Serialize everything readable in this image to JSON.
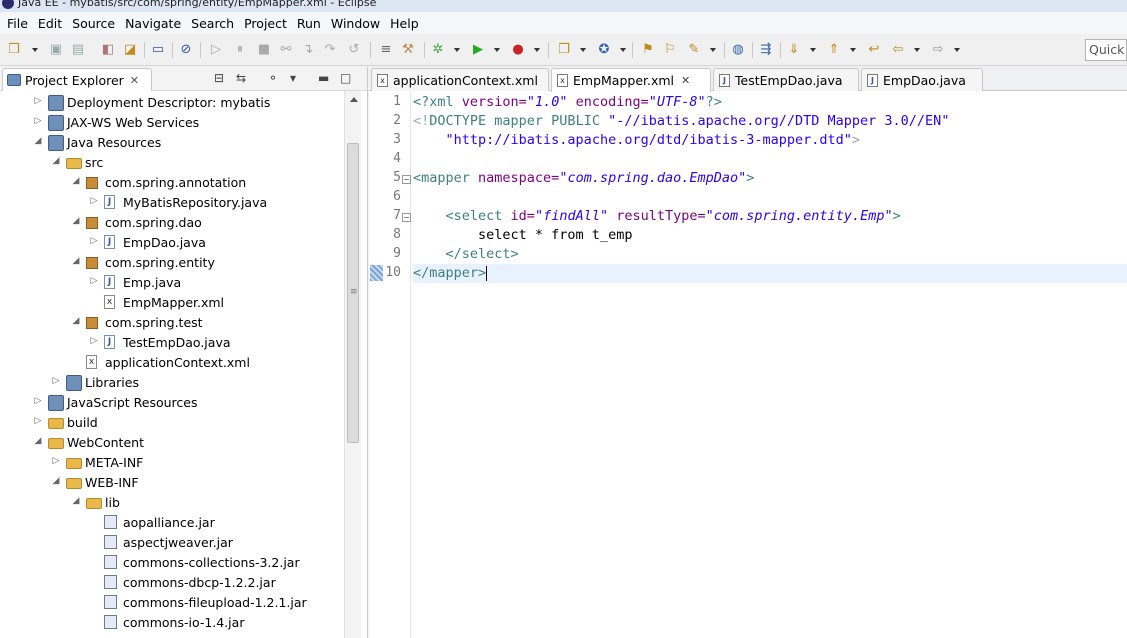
{
  "window": {
    "title": "Java EE - mybatis/src/com/spring/entity/EmpMapper.xml - Eclipse"
  },
  "menu": [
    "File",
    "Edit",
    "Source",
    "Navigate",
    "Search",
    "Project",
    "Run",
    "Window",
    "Help"
  ],
  "toolbar": {
    "quick_access": "Quick A"
  },
  "project_explorer": {
    "title": "Project Explorer",
    "items": [
      {
        "label": "Deployment Descriptor: mybatis",
        "icon": "deployment-descriptor-icon",
        "twisty": "collapsed"
      },
      {
        "label": "JAX-WS Web Services",
        "icon": "web-services-icon",
        "twisty": "collapsed"
      },
      {
        "label": "Java Resources",
        "icon": "java-resources-icon",
        "twisty": "expanded"
      },
      {
        "label": "src",
        "icon": "source-folder-icon",
        "twisty": "expanded"
      },
      {
        "label": "com.spring.annotation",
        "icon": "package-icon",
        "twisty": "expanded"
      },
      {
        "label": "MyBatisRepository.java",
        "icon": "java-file-icon",
        "twisty": "collapsed"
      },
      {
        "label": "com.spring.dao",
        "icon": "package-icon",
        "twisty": "expanded"
      },
      {
        "label": "EmpDao.java",
        "icon": "java-file-icon",
        "twisty": "collapsed"
      },
      {
        "label": "com.spring.entity",
        "icon": "package-icon",
        "twisty": "expanded"
      },
      {
        "label": "Emp.java",
        "icon": "java-file-icon",
        "twisty": "collapsed"
      },
      {
        "label": "EmpMapper.xml",
        "icon": "xml-file-icon",
        "twisty": "none"
      },
      {
        "label": "com.spring.test",
        "icon": "package-icon",
        "twisty": "expanded"
      },
      {
        "label": "TestEmpDao.java",
        "icon": "java-file-icon",
        "twisty": "collapsed"
      },
      {
        "label": "applicationContext.xml",
        "icon": "xml-file-icon",
        "twisty": "none"
      },
      {
        "label": "Libraries",
        "icon": "libraries-icon",
        "twisty": "collapsed"
      },
      {
        "label": "JavaScript Resources",
        "icon": "javascript-resources-icon",
        "twisty": "collapsed"
      },
      {
        "label": "build",
        "icon": "folder-icon",
        "twisty": "collapsed"
      },
      {
        "label": "WebContent",
        "icon": "folder-icon",
        "twisty": "expanded"
      },
      {
        "label": "META-INF",
        "icon": "folder-icon",
        "twisty": "collapsed"
      },
      {
        "label": "WEB-INF",
        "icon": "folder-icon",
        "twisty": "expanded"
      },
      {
        "label": "lib",
        "icon": "folder-icon",
        "twisty": "expanded"
      },
      {
        "label": "aopalliance.jar",
        "icon": "jar-file-icon",
        "twisty": "none"
      },
      {
        "label": "aspectjweaver.jar",
        "icon": "jar-file-icon",
        "twisty": "none"
      },
      {
        "label": "commons-collections-3.2.jar",
        "icon": "jar-file-icon",
        "twisty": "none"
      },
      {
        "label": "commons-dbcp-1.2.2.jar",
        "icon": "jar-file-icon",
        "twisty": "none"
      },
      {
        "label": "commons-fileupload-1.2.1.jar",
        "icon": "jar-file-icon",
        "twisty": "none"
      },
      {
        "label": "commons-io-1.4.jar",
        "icon": "jar-file-icon",
        "twisty": "none"
      }
    ]
  },
  "editor": {
    "tabs": [
      {
        "label": "applicationContext.xml",
        "icon": "xml-file-icon",
        "active": false
      },
      {
        "label": "EmpMapper.xml",
        "icon": "xml-file-icon",
        "active": true
      },
      {
        "label": "TestEmpDao.java",
        "icon": "java-file-icon",
        "active": false
      },
      {
        "label": "EmpDao.java",
        "icon": "java-file-icon",
        "active": false
      }
    ],
    "line_numbers": [
      "1",
      "2",
      "3",
      "4",
      "5",
      "6",
      "7",
      "8",
      "9",
      "10"
    ],
    "code": {
      "l1_open": "<?xml ",
      "l1_a1": "version=",
      "l1_v1": "\"1.0\"",
      "l1_a2": " encoding=",
      "l1_v2": "\"UTF-8\"",
      "l1_close": "?>",
      "l2_open": "<!",
      "l2_doctype": "DOCTYPE mapper PUBLIC ",
      "l2_str": "\"-//ibatis.apache.org//DTD Mapper 3.0//EN\"",
      "l3_indent": "    ",
      "l3_str": "\"http://ibatis.apache.org/dtd/ibatis-3-mapper.dtd\"",
      "l3_close": ">",
      "l5_open": "<mapper ",
      "l5_a1": "namespace=",
      "l5_v1": "\"com.spring.dao.EmpDao\"",
      "l5_close": ">",
      "l7_indent": "    ",
      "l7_open": "<select ",
      "l7_a1": "id=",
      "l7_v1": "\"findAll\"",
      "l7_a2": " resultType=",
      "l7_v2": "\"com.spring.entity.Emp\"",
      "l7_close": ">",
      "l8_text": "        select * from t_emp",
      "l9_indent": "    ",
      "l9_tag": "</select>",
      "l10_tag": "</mapper>"
    }
  }
}
